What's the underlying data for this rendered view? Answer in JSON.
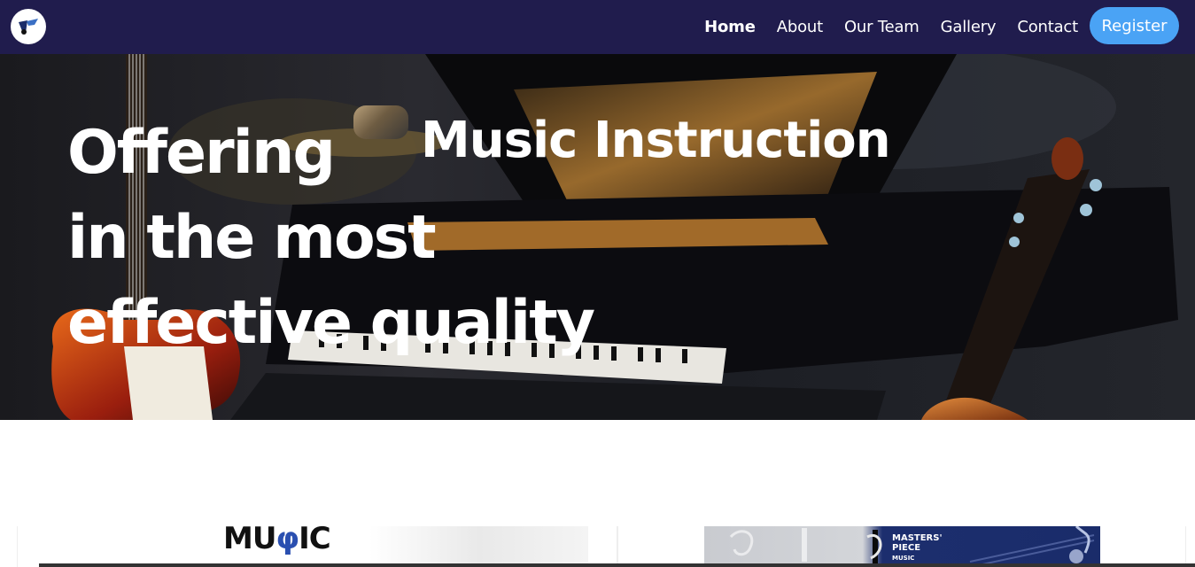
{
  "nav": {
    "links": [
      {
        "label": "Home",
        "active": true
      },
      {
        "label": "About"
      },
      {
        "label": "Our Team"
      },
      {
        "label": "Gallery"
      },
      {
        "label": "Contact"
      }
    ],
    "register_label": "Register"
  },
  "hero": {
    "line1a": "Offering",
    "line1b": "Music Instruction",
    "line2": "in the most",
    "line3": "effective quality"
  },
  "cards": {
    "left_logo_text": "MU\u0001IC",
    "right_logo_text": "MASTERS' PIECE MUSIC HOUSE"
  },
  "colors": {
    "nav_bg": "#201c4d",
    "accent": "#4aa3f5"
  }
}
